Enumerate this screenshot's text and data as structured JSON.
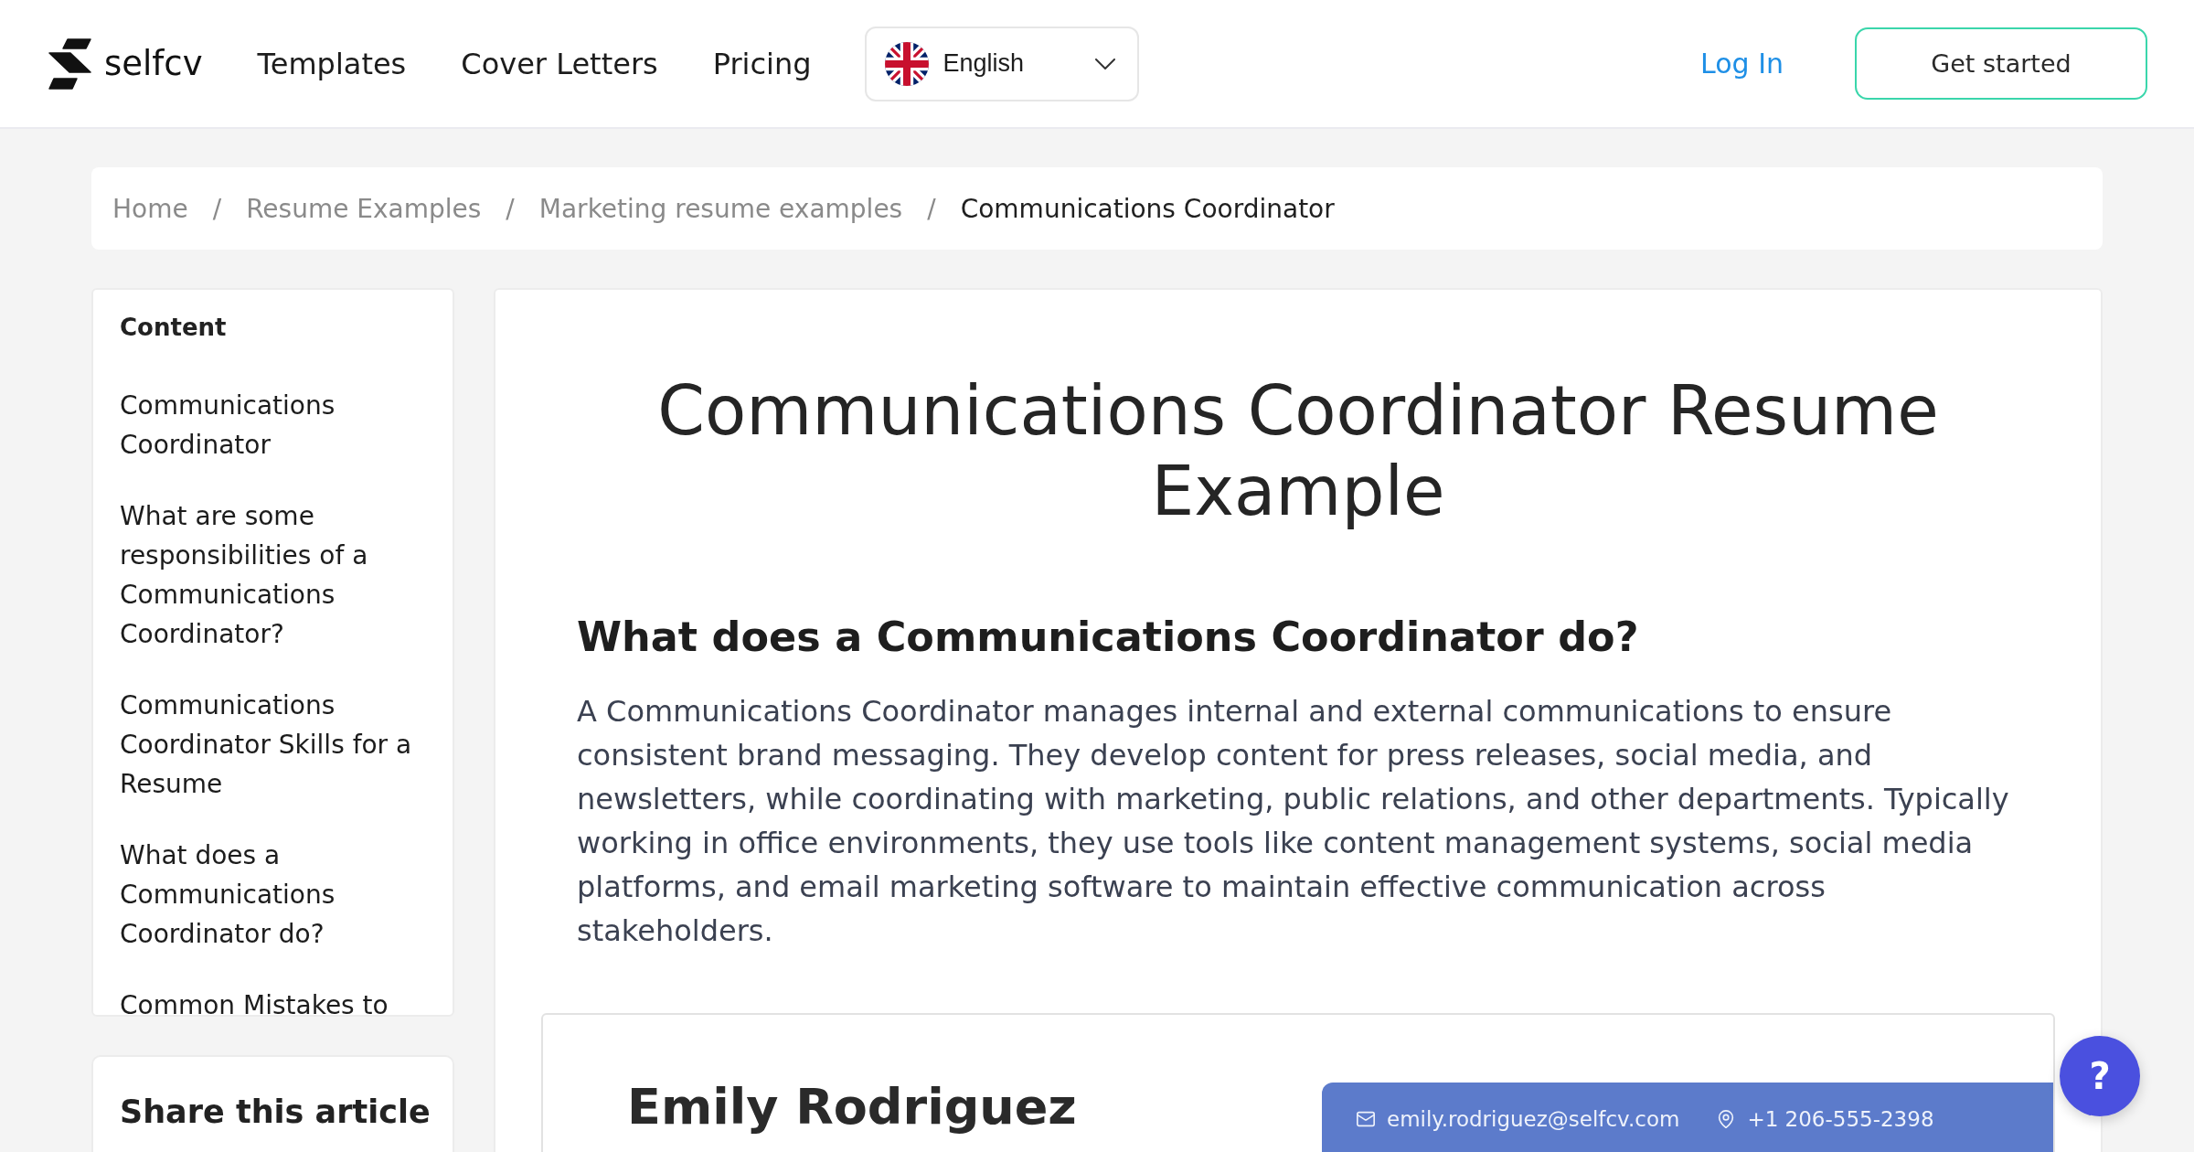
{
  "header": {
    "logo": "selfcv",
    "nav": [
      "Templates",
      "Cover Letters",
      "Pricing"
    ],
    "language": "English",
    "login": "Log In",
    "cta": "Get started"
  },
  "breadcrumb": [
    {
      "label": "Home",
      "current": false
    },
    {
      "separator": "/",
      "label": "Resume Examples",
      "current": false
    },
    {
      "separator": "/",
      "label": "Marketing resume examples",
      "current": false
    },
    {
      "separator": "/",
      "label": "Communications Coordinator",
      "current": true
    }
  ],
  "sidebar": {
    "title": "Content",
    "items": [
      "Communications Coordinator",
      "What are some responsibilities of a Communications Coordinator?",
      "Communications Coordinator Skills for a Resume",
      "What does a Communications Coordinator do?",
      "Common Mistakes to"
    ]
  },
  "share": {
    "title": "Share this article"
  },
  "article": {
    "title": "Communications Coordinator Resume Example",
    "heading": "What does a Communications Coordinator do?",
    "paragraph": "A Communications Coordinator manages internal and external communications to ensure consistent brand messaging. They develop content for press releases, social media, and newsletters, while coordinating with marketing, public relations, and other departments. Typically working in office environments, they use tools like content management systems, social media platforms, and email marketing software to maintain effective communication across stakeholders."
  },
  "resume_preview": {
    "name": "Emily Rodriguez",
    "email": "emily.rodriguez@selfcv.com",
    "phone": "+1 206-555-2398"
  },
  "help_button": {
    "label": "?"
  }
}
